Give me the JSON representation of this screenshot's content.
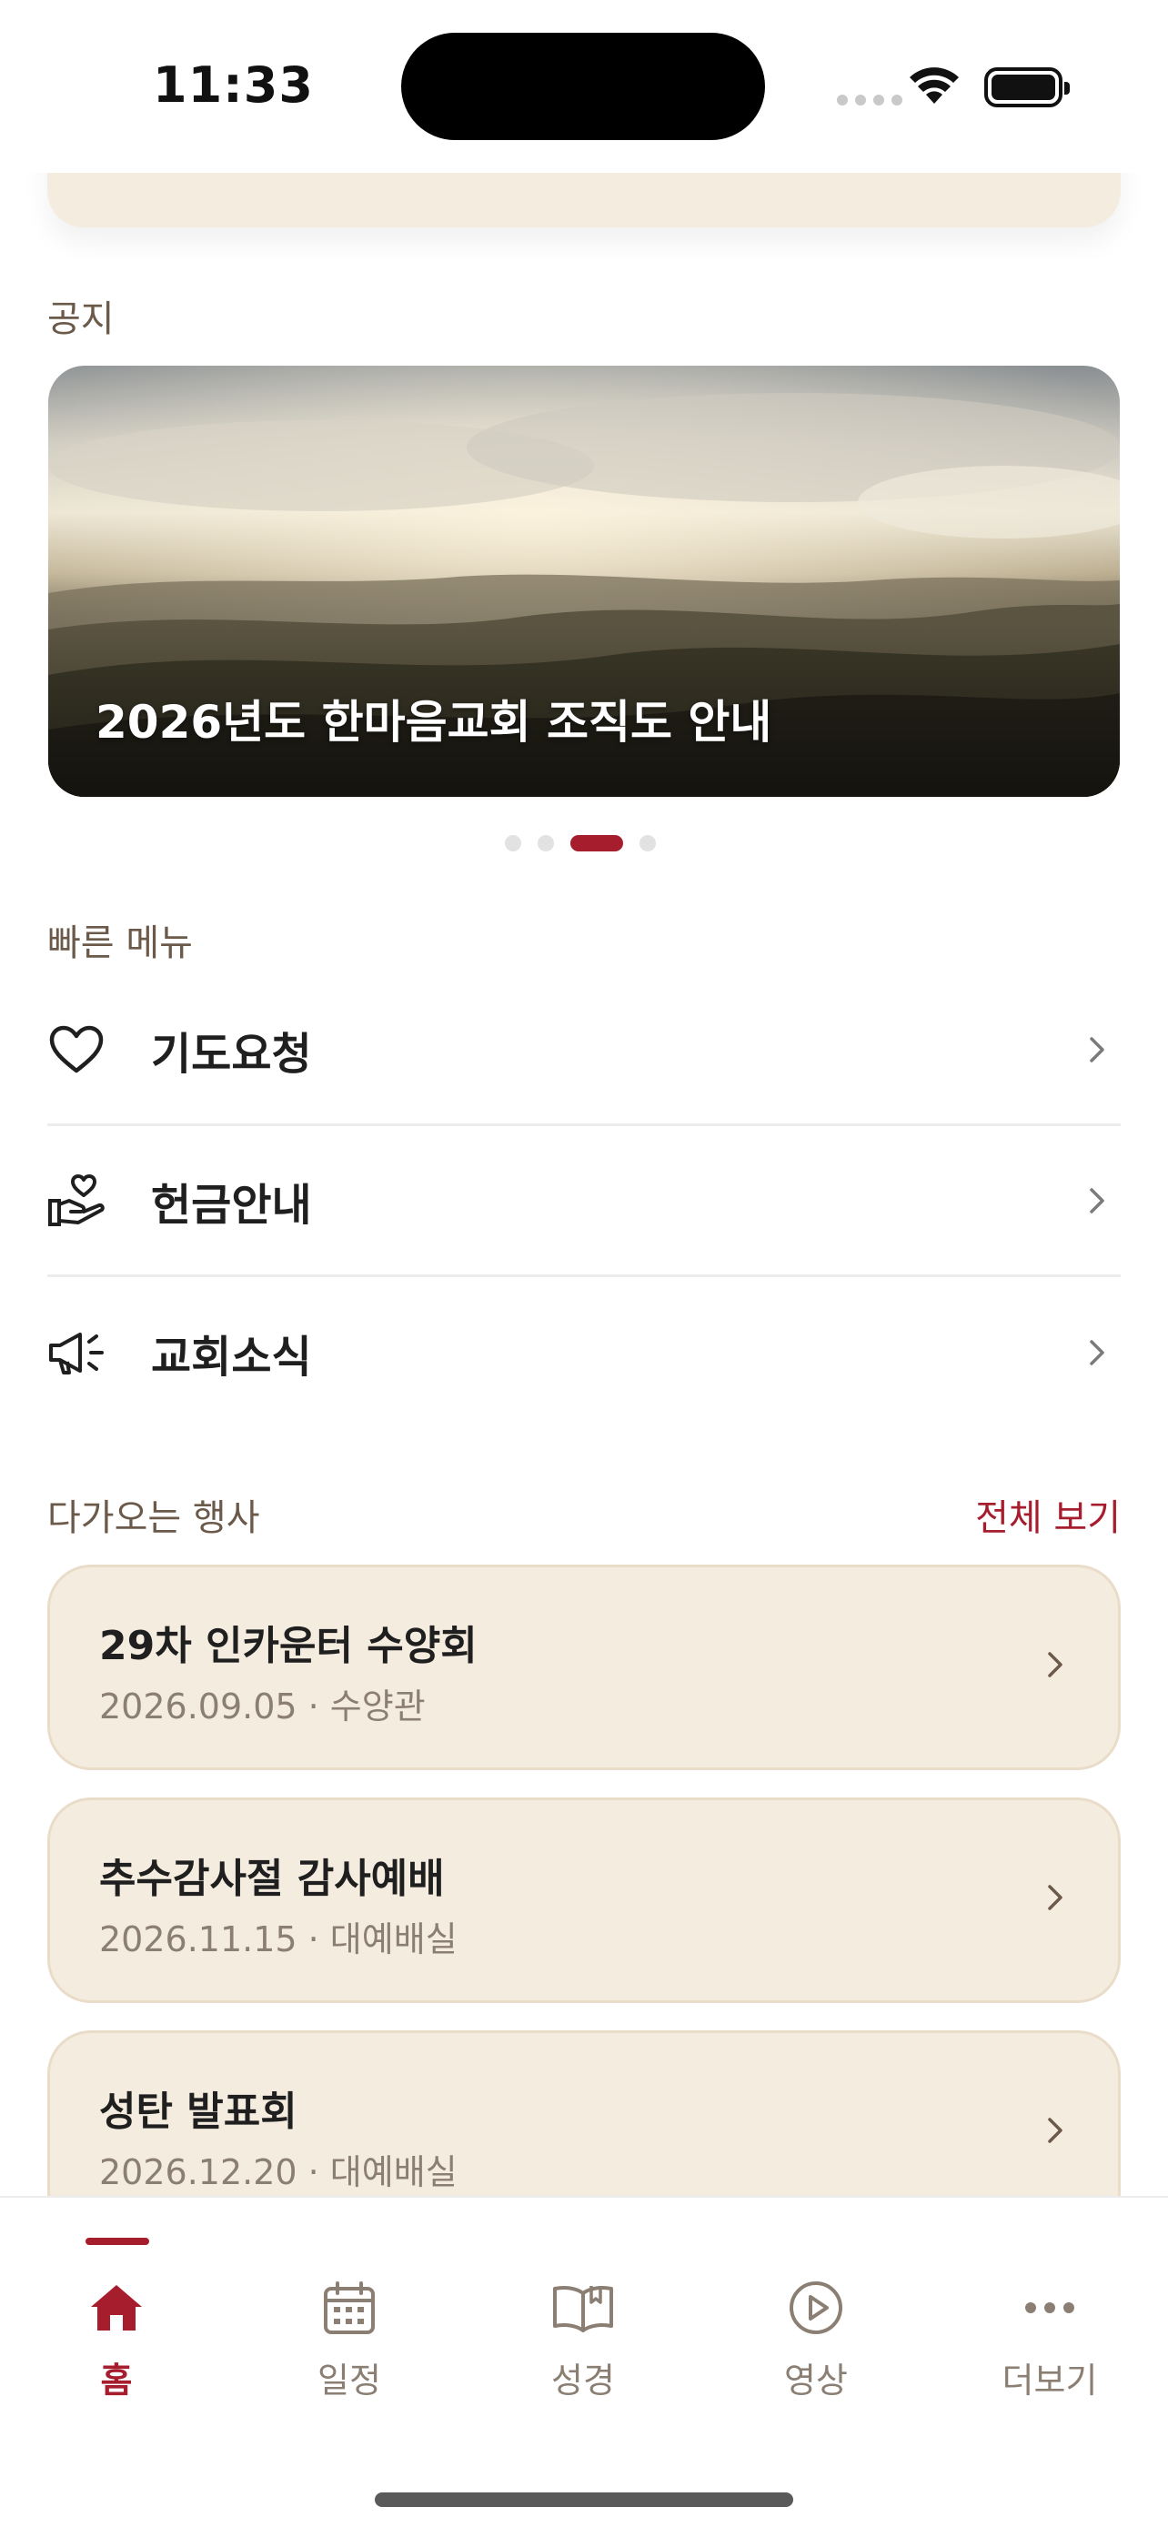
{
  "status_bar": {
    "time": "11:33"
  },
  "notice": {
    "section_label": "공지",
    "banner_title": "2026년도 한마음교회 조직도 안내",
    "carousel_total": 4,
    "carousel_active_index": 2
  },
  "quick_menu": {
    "section_label": "빠른 메뉴",
    "items": [
      {
        "label": "기도요청",
        "icon": "heart-icon"
      },
      {
        "label": "헌금안내",
        "icon": "hand-heart-icon"
      },
      {
        "label": "교회소식",
        "icon": "megaphone-icon"
      }
    ]
  },
  "events": {
    "section_label": "다가오는 행사",
    "view_all_label": "전체 보기",
    "items": [
      {
        "title": "29차 인카운터 수양회",
        "meta": "2026.09.05 · 수양관"
      },
      {
        "title": "추수감사절 감사예배",
        "meta": "2026.11.15 · 대예배실"
      },
      {
        "title": "성탄 발표회",
        "meta": "2026.12.20 · 대예배실"
      }
    ]
  },
  "tab_bar": {
    "tabs": [
      {
        "label": "홈",
        "icon": "home-icon",
        "active": true
      },
      {
        "label": "일정",
        "icon": "calendar-icon",
        "active": false
      },
      {
        "label": "성경",
        "icon": "book-icon",
        "active": false
      },
      {
        "label": "영상",
        "icon": "play-icon",
        "active": false
      },
      {
        "label": "더보기",
        "icon": "more-icon",
        "active": false
      }
    ]
  },
  "colors": {
    "accent": "#a61e2e",
    "card_bg": "#f5ece0",
    "muted_text": "#8b7e72"
  }
}
